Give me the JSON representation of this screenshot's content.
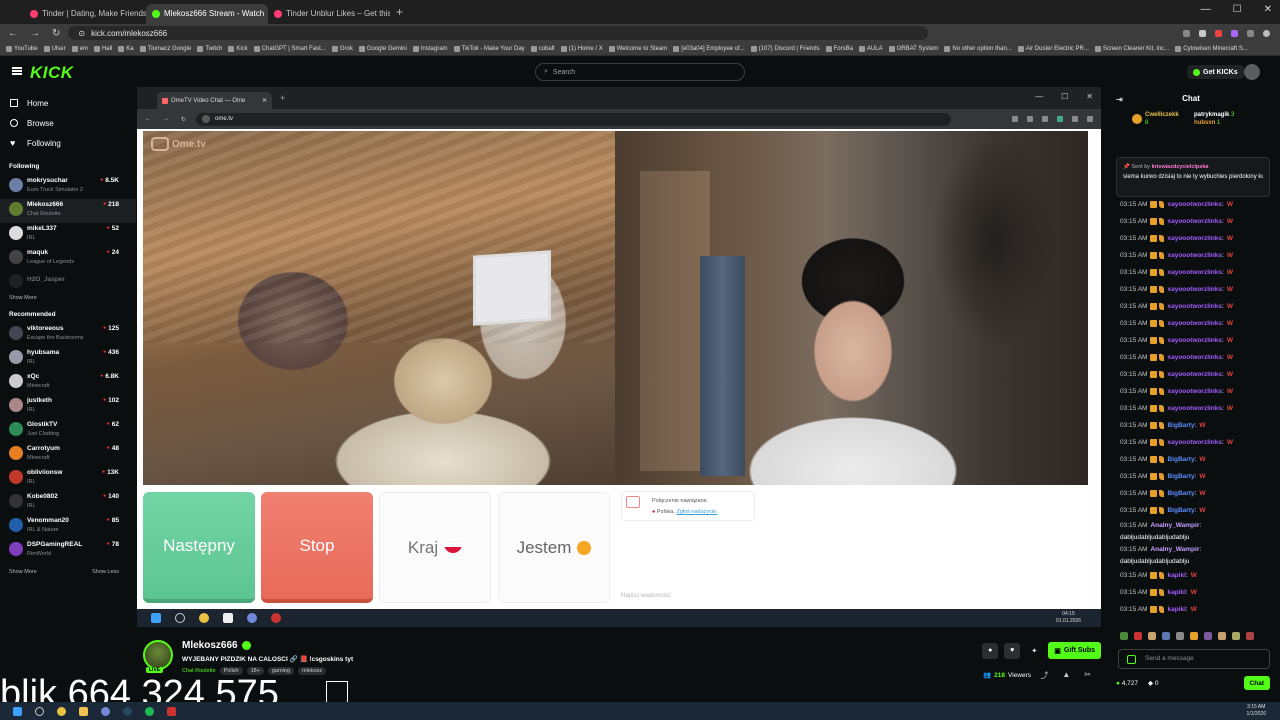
{
  "browser": {
    "tabs": [
      {
        "label": "Tinder | Dating, Make Friends &",
        "color": "#fe3c72",
        "active": false
      },
      {
        "label": "Mlekosz666 Stream - Watch",
        "color": "#53fc18",
        "active": true
      },
      {
        "label": "Tinder Unblur Likes – Get this E",
        "color": "#fe3c72",
        "active": false
      }
    ],
    "url": "kick.com/mlekosz666",
    "bookmarks": [
      "YouTube",
      "Ulser",
      "em",
      "Hall",
      "Ka",
      "Tłumacz Google",
      "Twitch",
      "Kick",
      "ChatGPT | Smart Fast...",
      "Grok",
      "Google Gemini",
      "Instagram",
      "TikTok - Make Your Day",
      "cobalt",
      "(1) Home / X",
      "Welcome to Steam",
      "[e03a04] Employee of...",
      "(107) Discord | Friends",
      "ForsBa",
      "AULA",
      "ORBAT System",
      "No other option than...",
      "Air Duster Electric PR...",
      "Screen Cleaner Kit, inc...",
      "Cytowisen Minecraft S..."
    ]
  },
  "header": {
    "logo": "KICK",
    "search_placeholder": "Search",
    "get_kicks": "Get KICKs"
  },
  "sidebar": {
    "nav": [
      {
        "label": "Home",
        "icon": "home-icon"
      },
      {
        "label": "Browse",
        "icon": "browse-icon"
      },
      {
        "label": "Following",
        "icon": "heart-icon"
      }
    ],
    "following_title": "Following",
    "following": [
      {
        "name": "mokrysuchar",
        "category": "Euro Truck Simulator 2",
        "viewers": "8.5K",
        "color": "#6b7fa8"
      },
      {
        "name": "Mlekosz666",
        "category": "Chat Roulette",
        "viewers": "218",
        "color": "#5e7d2e"
      },
      {
        "name": "mikeL337",
        "category": "IRL",
        "viewers": "52",
        "color": "#ddd"
      },
      {
        "name": "maquk",
        "category": "League of Legends",
        "viewers": "24",
        "color": "#444"
      }
    ],
    "offline": "H2O_Jasper",
    "show_more": "Show More",
    "recommended_title": "Recommended",
    "recommended": [
      {
        "name": "viktoreeous",
        "category": "Escape the Backrooms",
        "viewers": "125",
        "color": "#445"
      },
      {
        "name": "hyubsama",
        "category": "IRL",
        "viewers": "436",
        "color": "#99a"
      },
      {
        "name": "xQc",
        "category": "Minecraft",
        "viewers": "6.8K",
        "color": "#ccc"
      },
      {
        "name": "justketh",
        "category": "IRL",
        "viewers": "102",
        "color": "#a88"
      },
      {
        "name": "GlostikTV",
        "category": "Just Chatting",
        "viewers": "62",
        "color": "#2e8b57"
      },
      {
        "name": "Carrotyum",
        "category": "Minecraft",
        "viewers": "48",
        "color": "#e67e22"
      },
      {
        "name": "obliviionsw",
        "category": "IRL",
        "viewers": "13K",
        "color": "#c0392b"
      },
      {
        "name": "Kobe0802",
        "category": "IRL",
        "viewers": "140",
        "color": "#333"
      },
      {
        "name": "Venomman20",
        "category": "IRL & Nature",
        "viewers": "85",
        "color": "#1e5fa8"
      },
      {
        "name": "DSPGamingREAL",
        "category": "RimWorld",
        "viewers": "78",
        "color": "#7f3fbf"
      }
    ],
    "show_more2": "Show More",
    "show_less": "Show Less"
  },
  "stream": {
    "inner_tab": "OmeTV Video Chat — Ome",
    "inner_url": "ome.tv",
    "ome_logo": "Ome.tv",
    "buttons": {
      "next": "Następny",
      "stop": "Stop",
      "country": "Kraj",
      "gender": "Jestem"
    },
    "notice_line1": "Połączenie nawiązane.",
    "notice_country": "Polska.",
    "notice_report": "Zgłoś nadużycie.",
    "message_placeholder": "Napisz wiadomość",
    "clock_time": "04:15",
    "clock_date": "01.01.2026"
  },
  "chat": {
    "title": "Chat",
    "gifters": [
      {
        "name": "Cwelliczekk",
        "count": "8"
      },
      {
        "name": "patrykmagik",
        "count": "3"
      },
      {
        "name": "hubsxn",
        "count": "1"
      }
    ],
    "pinned_sender": "kriswiazdzycielcipska",
    "pinned_label": "Sent by",
    "pinned_text": "siema kurwo dzisiaj to nie ty wybuchies pierdolony kurwa arabie z pasem...",
    "messages": [
      {
        "time": "03:15 AM",
        "user": "xayoootworzlinks",
        "color": "#a25cff",
        "text": "W"
      },
      {
        "time": "03:15 AM",
        "user": "xayoootworzlinks",
        "color": "#a25cff",
        "text": "W"
      },
      {
        "time": "03:15 AM",
        "user": "xayoootworzlinks",
        "color": "#a25cff",
        "text": "W"
      },
      {
        "time": "03:15 AM",
        "user": "xayoootworzlinks",
        "color": "#a25cff",
        "text": "W"
      },
      {
        "time": "03:15 AM",
        "user": "xayoootworzlinks",
        "color": "#a25cff",
        "text": "W"
      },
      {
        "time": "03:15 AM",
        "user": "xayoootworzlinks",
        "color": "#a25cff",
        "text": "W"
      },
      {
        "time": "03:15 AM",
        "user": "xayoootworzlinks",
        "color": "#a25cff",
        "text": "W"
      },
      {
        "time": "03:15 AM",
        "user": "xayoootworzlinks",
        "color": "#a25cff",
        "text": "W"
      },
      {
        "time": "03:15 AM",
        "user": "xayoootworzlinks",
        "color": "#a25cff",
        "text": "W"
      },
      {
        "time": "03:15 AM",
        "user": "xayoootworzlinks",
        "color": "#a25cff",
        "text": "W"
      },
      {
        "time": "03:15 AM",
        "user": "xayoootworzlinks",
        "color": "#a25cff",
        "text": "W"
      },
      {
        "time": "03:15 AM",
        "user": "xayoootworzlinks",
        "color": "#a25cff",
        "text": "W"
      },
      {
        "time": "03:15 AM",
        "user": "xayoootworzlinks",
        "color": "#a25cff",
        "text": "W"
      },
      {
        "time": "03:15 AM",
        "user": "BigBarty",
        "color": "#5b8cff",
        "text": "W"
      },
      {
        "time": "03:15 AM",
        "user": "xayoootworzlinks",
        "color": "#a25cff",
        "text": "W"
      },
      {
        "time": "03:15 AM",
        "user": "BigBarty",
        "color": "#5b8cff",
        "text": "W"
      },
      {
        "time": "03:15 AM",
        "user": "BigBarty",
        "color": "#5b8cff",
        "text": "W"
      },
      {
        "time": "03:15 AM",
        "user": "BigBarty",
        "color": "#5b8cff",
        "text": "W"
      },
      {
        "time": "03:15 AM",
        "user": "BigBarty",
        "color": "#5b8cff",
        "text": "W"
      }
    ],
    "long_messages": [
      {
        "time": "03:15 AM",
        "user": "Analny_Wampir",
        "color": "#c7a0ff",
        "text": "dabljudabljudabljudablju"
      },
      {
        "time": "03:15 AM",
        "user": "Analny_Wampir",
        "color": "#c7a0ff",
        "text": "dabljudabljudabljudablju"
      }
    ],
    "tail_messages": [
      {
        "time": "03:15 AM",
        "user": "kapikl",
        "color": "#a25cff",
        "text": "W"
      },
      {
        "time": "03:15 AM",
        "user": "kapikl",
        "color": "#a25cff",
        "text": "W"
      },
      {
        "time": "03:15 AM",
        "user": "kapikl",
        "color": "#a25cff",
        "text": "W"
      }
    ],
    "send_placeholder": "Send a message",
    "kicks_count": "4,727",
    "bits_count": "0",
    "chat_button": "Chat"
  },
  "streamer": {
    "name": "Mlekosz666",
    "title": "WYJEBANY PIZDZIK NA CALOSCI 🔗 📕 !csgoskins tyt",
    "category": "Chat Roulette",
    "tags": [
      "Polish",
      "18+",
      "gaming",
      "mlekosz"
    ],
    "live": "LIVE",
    "viewers": "218",
    "viewers_label": "Viewers",
    "gift_subs": "Gift Subs"
  },
  "overlay": {
    "text": "blik 664 324 575"
  },
  "os": {
    "time": "3:15 AM",
    "date": "1/1/2026"
  }
}
